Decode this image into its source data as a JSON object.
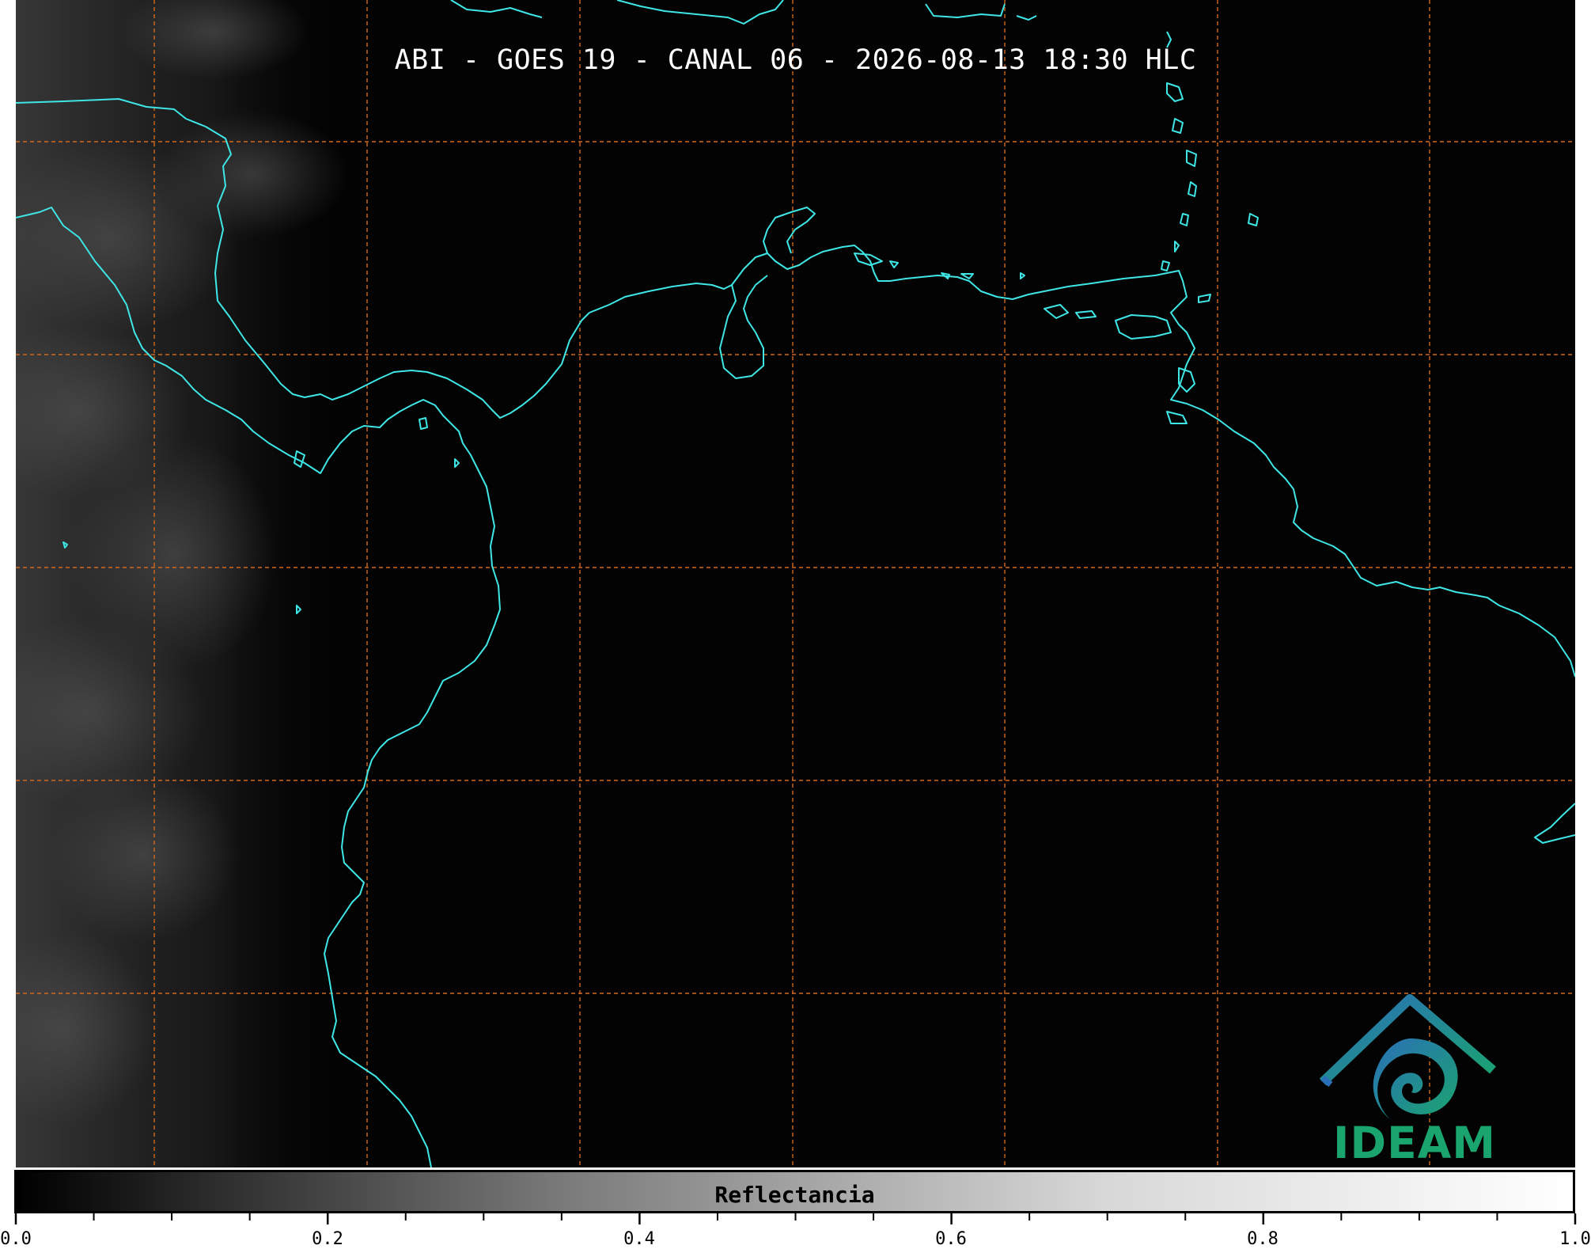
{
  "title": "ABI - GOES 19 - CANAL 06 - 2026-08-13 18:30 HLC",
  "colorbar": {
    "label": "Reflectancia",
    "min": 0.0,
    "max": 1.0,
    "tick_labels": [
      "0.0",
      "0.2",
      "0.4",
      "0.6",
      "0.8",
      "1.0"
    ],
    "colormap": "grayscale"
  },
  "map": {
    "coastline_color": "#3fe6e6",
    "gridline_color": "#d2691e",
    "gridline_style": "dashed",
    "background_color": "#030303"
  },
  "logo": {
    "text": "IDEAM",
    "colors": [
      "#2a6fb8",
      "#1aa56e"
    ]
  }
}
